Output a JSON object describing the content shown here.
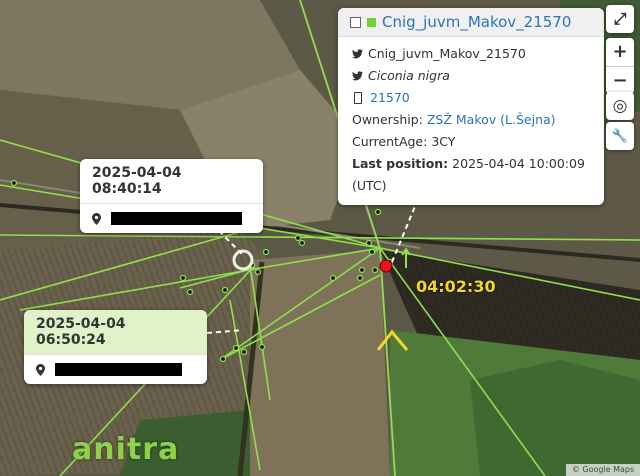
{
  "info_popup": {
    "title": "Cnig_juvm_Makov_21570",
    "name": "Cnig_juvm_Makov_21570",
    "species": "Ciconia nigra",
    "device_id": "21570",
    "ownership_label": "Ownership:",
    "ownership_value": "ZSŽ Makov (L.Šejna)",
    "current_age_label": "CurrentAge:",
    "current_age_value": "3CY",
    "last_position_label": "Last position:",
    "last_position_value": "2025-04-04 10:00:09 (UTC)"
  },
  "position_popups": [
    {
      "timestamp": "2025-04-04 08:40:14"
    },
    {
      "timestamp": "2025-04-04 06:50:24"
    }
  ],
  "time_label": "04:02:30",
  "logo_text": "anitra",
  "attribution": "© Google Maps",
  "controls": {
    "fullscreen": "⤢",
    "zoom_in": "+",
    "zoom_out": "−",
    "locate": "◎",
    "settings": "🔧"
  },
  "colors": {
    "track": "#8fe04c",
    "last_position": "#e8141a",
    "time_label": "#f2d629",
    "accent": "#2a73c0"
  }
}
